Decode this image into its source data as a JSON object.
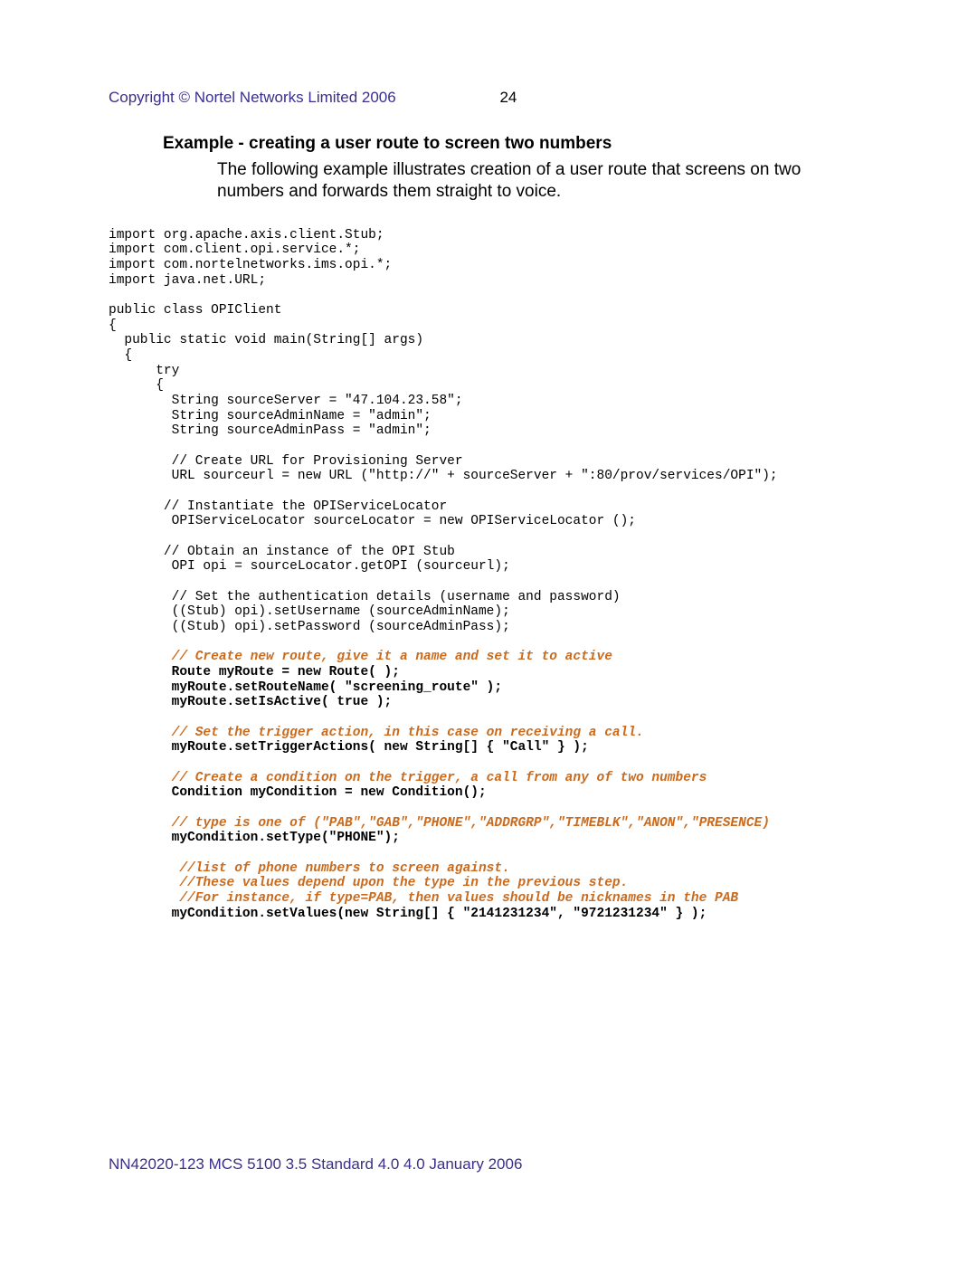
{
  "header": {
    "copyright": "Copyright © Nortel Networks Limited 2006",
    "page_number": "24"
  },
  "section": {
    "heading": "Example - creating a user route to screen two numbers",
    "body": "The following example illustrates creation of a user route that screens on two numbers and forwards them straight to voice."
  },
  "code": {
    "import1": "import org.apache.axis.client.Stub;",
    "import2": "import com.client.opi.service.*;",
    "import3": "import com.nortelnetworks.ims.opi.*;",
    "import4": "import java.net.URL;",
    "classdecl": "public class OPIClient",
    "brace_open": "{",
    "main_sig": "  public static void main(String[] args)",
    "brace_open2": "  {",
    "try_line": "      try",
    "brace_open3": "      {",
    "src_server": "        String sourceServer = \"47.104.23.58\";",
    "src_admin": "        String sourceAdminName = \"admin\";",
    "src_pass": "        String sourceAdminPass = \"admin\";",
    "cmt_url": "        // Create URL for Provisioning Server",
    "url_line": "        URL sourceurl = new URL (\"http://\" + sourceServer + \":80/prov/services/OPI\");",
    "cmt_locator": "       // Instantiate the OPIServiceLocator",
    "locator_line": "        OPIServiceLocator sourceLocator = new OPIServiceLocator ();",
    "cmt_stub": "       // Obtain an instance of the OPI Stub",
    "stub_line": "        OPI opi = sourceLocator.getOPI (sourceurl);",
    "cmt_auth": "        // Set the authentication details (username and password)",
    "auth_user": "        ((Stub) opi).setUsername (sourceAdminName);",
    "auth_pass": "        ((Stub) opi).setPassword (sourceAdminPass);",
    "cmt_route": "        // Create new route, give it a name and set it to active",
    "route1": "        Route myRoute = new Route( );",
    "route2": "        myRoute.setRouteName( \"screening_route\" );",
    "route3": "        myRoute.setIsActive( true );",
    "cmt_trigger": "        // Set the trigger action, in this case on receiving a call.",
    "trigger": "        myRoute.setTriggerActions( new String[] { \"Call\" } );",
    "cmt_cond": "        // Create a condition on the trigger, a call from any of two numbers",
    "cond": "        Condition myCondition = new Condition();",
    "cmt_type": "        // type is one of (\"PAB\",\"GAB\",\"PHONE\",\"ADDRGRP\",\"TIMEBLK\",\"ANON\",\"PRESENCE)",
    "type": "        myCondition.setType(\"PHONE\");",
    "cmt_list1": "         //list of phone numbers to screen against.",
    "cmt_list2": "         //These values depend upon the type in the previous step.",
    "cmt_list3": "         //For instance, if type=PAB, then values should be nicknames in the PAB",
    "values": "        myCondition.setValues(new String[] { \"2141231234\", \"9721231234\" } );"
  },
  "footer": {
    "text": "NN42020-123   MCS 5100 3.5   Standard 4.0   4.0   January 2006"
  }
}
